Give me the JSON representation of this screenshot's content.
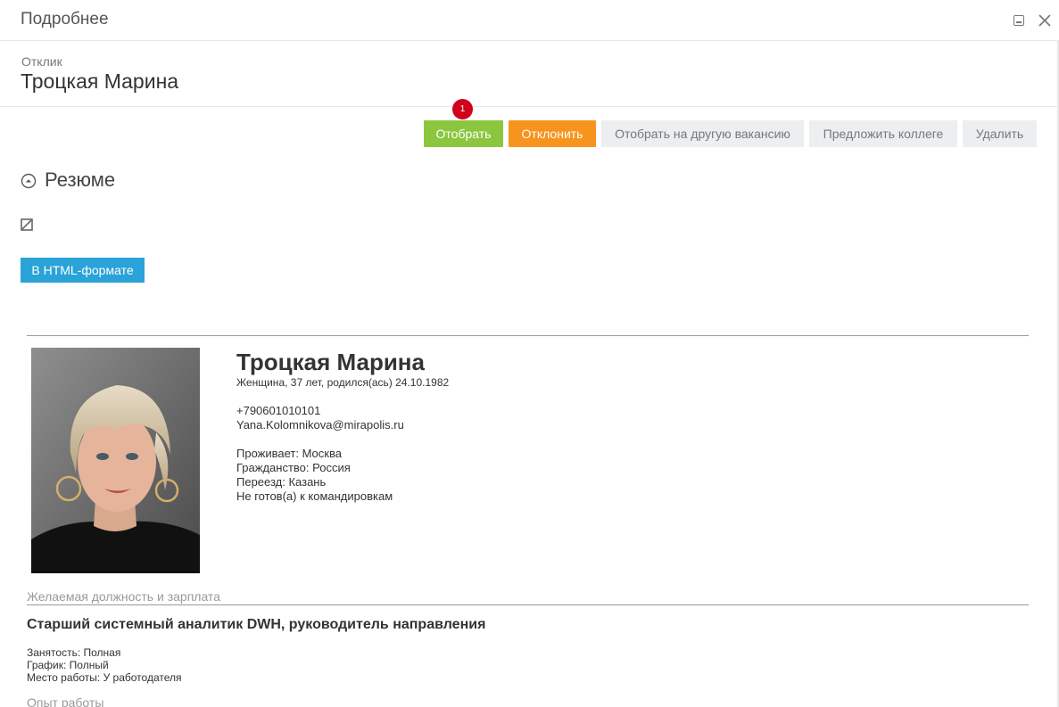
{
  "window": {
    "title": "Подробнее"
  },
  "header": {
    "subtitle": "Отклик",
    "name": "Троцкая Марина"
  },
  "actions": {
    "select": "Отобрать",
    "reject": "Отклонить",
    "select_other": "Отобрать на другую вакансию",
    "suggest": "Предложить коллеге",
    "delete": "Удалить",
    "badge": "1"
  },
  "resume_section": {
    "title": "Резюме",
    "html_button": "В HTML-формате"
  },
  "resume": {
    "name": "Троцкая Марина",
    "meta": "Женщина, 37 лет, родился(ась) 24.10.1982",
    "phone": "+790601010101",
    "email": "Yana.Kolomnikova@mirapolis.ru",
    "city": "Проживает: Москва",
    "citizenship": "Гражданство: Россия",
    "relocation": "Переезд: Казань",
    "travel": "Не готов(а) к командировкам"
  },
  "desired": {
    "caption": "Желаемая должность и зарплата",
    "position": "Старший системный аналитик DWH, руководитель направления",
    "employment": "Занятость: Полная",
    "schedule": "График: Полный",
    "workplace": "Место работы: У работодателя"
  },
  "experience": {
    "caption": "Опыт работы"
  },
  "colors": {
    "select": "#8cc63f",
    "reject": "#f7941d",
    "html_button": "#29a3d8",
    "badge": "#d0021b"
  },
  "icons": {
    "minimize": "minimize-icon",
    "close": "close-icon",
    "collapse": "collapse-up-icon",
    "edit": "edit-icon"
  }
}
